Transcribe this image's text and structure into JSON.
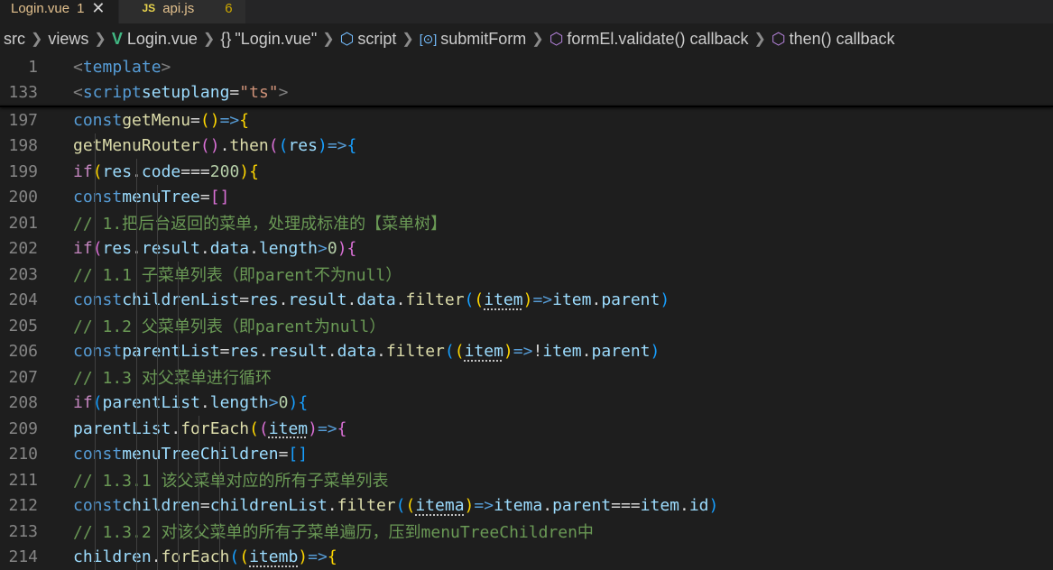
{
  "tabs": [
    {
      "label": "Login.vue",
      "badge": "1",
      "active": true
    },
    {
      "icon": "JS",
      "label": "api.js",
      "badge": "6",
      "active": false
    }
  ],
  "breadcrumb": {
    "src": "src",
    "views": "views",
    "file": "Login.vue",
    "component": "\"Login.vue\"",
    "script": "script",
    "submitForm": "submitForm",
    "validate": "formEl.validate() callback",
    "then": "then() callback"
  },
  "lines": {
    "l1": "1",
    "l133": "133",
    "l197": "197",
    "l198": "198",
    "l199": "199",
    "l200": "200",
    "l201": "201",
    "l202": "202",
    "l203": "203",
    "l204": "204",
    "l205": "205",
    "l206": "206",
    "l207": "207",
    "l208": "208",
    "l209": "209",
    "l210": "210",
    "l211": "211",
    "l212": "212",
    "l213": "213",
    "l214": "214"
  },
  "comments": {
    "c201": "// 1.把后台返回的菜单，处理成标准的【菜单树】",
    "c203": "// 1.1 子菜单列表（即parent不为null）",
    "c205": "// 1.2 父菜单列表（即parent为null）",
    "c207": "// 1.3 对父菜单进行循环",
    "c211": "// 1.3.1 该父菜单对应的所有子菜单列表",
    "c213": "// 1.3.2 对该父菜单的所有子菜单遍历，压到menuTreeChildren中"
  },
  "colors": {
    "background": "#1e1e1e",
    "keyword": "#569cd6",
    "function": "#dcdcaa",
    "variable": "#9cdcfe",
    "comment": "#6a9955",
    "number": "#b5cea8",
    "string": "#ce9178",
    "tab_modified": "#e2c08d"
  }
}
